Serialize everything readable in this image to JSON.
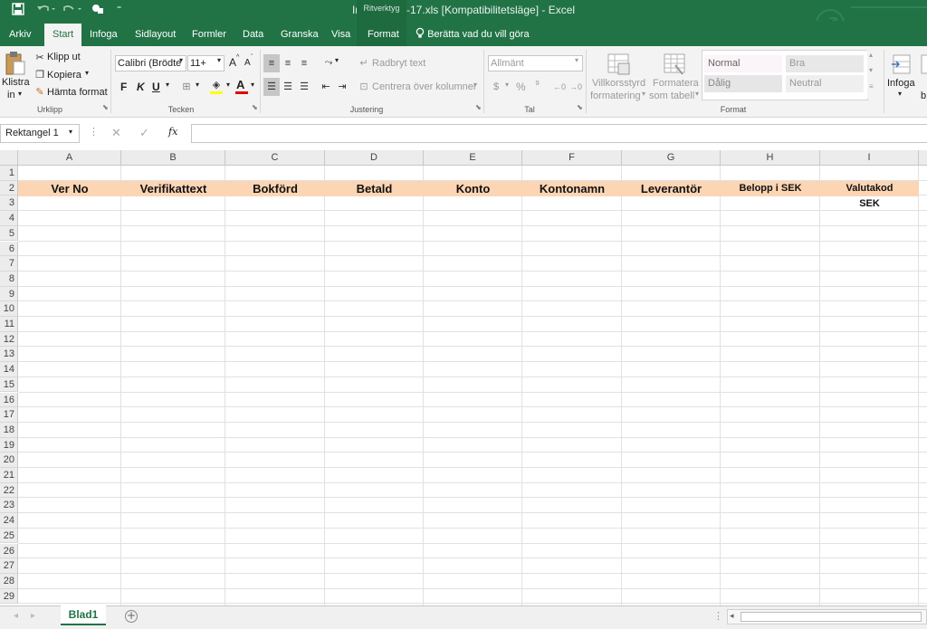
{
  "quick_access": {
    "save_icon": "save-icon",
    "undo_icon": "undo-icon",
    "redo_icon": "redo-icon",
    "touch_icon": "touch-mode-icon",
    "customize": "⁼"
  },
  "window_title": "Import-mall-17.xls  [Kompatibilitetsläge] - Excel",
  "contextual_label": "Ritverktyg",
  "tabs": {
    "arkiv": "Arkiv",
    "start": "Start",
    "infoga": "Infoga",
    "sidlayout": "Sidlayout",
    "formler": "Formler",
    "data": "Data",
    "granska": "Granska",
    "visa": "Visa",
    "format": "Format"
  },
  "tell_me": "Berätta vad du vill göra",
  "clipboard": {
    "paste_line1": "Klistra",
    "paste_line2": "in",
    "cut": "Klipp ut",
    "copy": "Kopiera",
    "format_painter": "Hämta format",
    "group": "Urklipp"
  },
  "font": {
    "name": "Calibri (Brödte",
    "size": "11+",
    "grow": "A",
    "shrink": "A",
    "bold": "F",
    "italic": "K",
    "underline": "U",
    "group": "Tecken"
  },
  "alignment": {
    "wrap": "Radbryt text",
    "merge": "Centrera över kolumner",
    "group": "Justering"
  },
  "number": {
    "format": "Allmänt",
    "percent": "%",
    "comma": "⁹",
    "group": "Tal"
  },
  "styles": {
    "conditional_line1": "Villkorsstyrd",
    "conditional_line2": "formatering",
    "table_line1": "Formatera",
    "table_line2": "som tabell",
    "normal": "Normal",
    "good": "Bra",
    "bad": "Dålig",
    "neutral": "Neutral",
    "group": "Format"
  },
  "cells": {
    "insert": "Infoga",
    "b_partial": "b"
  },
  "formula_bar": {
    "name_box": "Rektangel 1",
    "fx": "fx",
    "value": ""
  },
  "columns": [
    "A",
    "B",
    "C",
    "D",
    "E",
    "F",
    "G",
    "H",
    "I"
  ],
  "rows": [
    "1",
    "2",
    "3",
    "4",
    "5",
    "6",
    "7",
    "8",
    "9",
    "10",
    "11",
    "12",
    "13",
    "14",
    "15",
    "16",
    "17",
    "18",
    "19",
    "20",
    "21",
    "22",
    "23",
    "24",
    "25",
    "26",
    "27",
    "28",
    "29"
  ],
  "header_row": [
    "Ver No",
    "Verifikattext",
    "Bokförd",
    "Betald",
    "Konto",
    "Kontonamn",
    "Leverantör",
    "Belopp i SEK",
    "Valutakod"
  ],
  "cell_I3": "SEK",
  "sheets": {
    "active": "Blad1"
  },
  "colors": {
    "accent": "#217346",
    "header_fill": "#fcd5b4"
  }
}
